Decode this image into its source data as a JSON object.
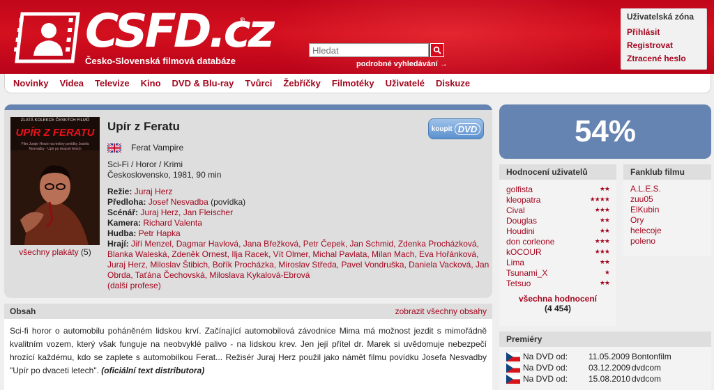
{
  "header": {
    "logo": "CSFD.cz",
    "reg": "®",
    "tagline": "Česko-Slovenská filmová databáze",
    "search_placeholder": "Hledat",
    "adv_search": "podrobné vyhledávání →",
    "user_zone": {
      "title": "Uživatelská zóna",
      "links": [
        "Přihlásit",
        "Registrovat",
        "Ztracené heslo"
      ]
    }
  },
  "nav": [
    "Novinky",
    "Videa",
    "Televize",
    "Kino",
    "DVD & Blu-ray",
    "Tvůrci",
    "Žebříčky",
    "Filmotéky",
    "Uživatelé",
    "Diskuze"
  ],
  "film": {
    "poster": {
      "collection": "ZLATÁ KOLEKCE ČESKÝCH FILMŮ",
      "title": "UPÍR Z FERATU",
      "sub": "Film Juraje Herze na motivy povídky Josefa Nesvadby · Upír po dvaceti letech"
    },
    "all_posters": "všechny plakáty",
    "posters_count": "(5)",
    "title": "Upír z Feratu",
    "alt_title": "Ferat Vampire",
    "genres": "Sci-Fi / Horor / Krimi",
    "origin": "Československo, 1981, 90 min",
    "buy": {
      "kup": "koupit",
      "dvd": "DVD"
    },
    "credits": {
      "directing_label": "Režie:",
      "directing": "Juraj Herz",
      "source_label": "Předloha:",
      "source": "Josef Nesvadba",
      "source_note": "(povídka)",
      "screenplay_label": "Scénář:",
      "screenplay": "Juraj Herz, Jan Fleischer",
      "camera_label": "Kamera:",
      "camera": "Richard Valenta",
      "music_label": "Hudba:",
      "music": "Petr Hapka",
      "cast_label": "Hrají:",
      "cast": "Jiří Menzel, Dagmar Havlová, Jana Břežková, Petr Čepek, Jan Schmid, Zdenka Procházková, Blanka Waleská, Zdeněk Ornest, Ilja Racek, Vít Olmer, Michal Pavlata, Milan Mach, Eva Hořánková, Juraj Herz, Miloslav Štibich, Bořík Procházka, Miroslav Středa, Pavel Vondruška, Daniela Vacková, Jan Obrda, Taťána Čechovská, Miloslava Kykalová-Ebrová",
      "more": "(další profese)"
    }
  },
  "content": {
    "title": "Obsah",
    "show_all": "zobrazit všechny obsahy",
    "plot": "Sci-fi horor o automobilu poháněném lidskou krví. Začínající automobilová závodnice Mima má možnost jezdit s mimořádně kvalitním vozem, který však funguje na neobvyklé palivo - na lidskou krev. Jen její přítel dr. Marek si uvědomuje nebezpečí hrozící každému, kdo se zaplete s automobilkou Ferat... Režisér Juraj Herz použil jako námět filmu povídku Josefa Nesvadby \"Upír po dvaceti letech\". ",
    "plot_source": "(oficiální text distributora)"
  },
  "rating": "54%",
  "user_ratings": {
    "title": "Hodnocení uživatelů",
    "items": [
      {
        "user": "golfista",
        "stars": "★★"
      },
      {
        "user": "kleopatra",
        "stars": "★★★★"
      },
      {
        "user": "Cival",
        "stars": "★★★"
      },
      {
        "user": "Douglas",
        "stars": "★★"
      },
      {
        "user": "Houdini",
        "stars": "★★"
      },
      {
        "user": "don corleone",
        "stars": "★★★"
      },
      {
        "user": "kOCOUR",
        "stars": "★★★"
      },
      {
        "user": "Lima",
        "stars": "★★"
      },
      {
        "user": "Tsunami_X",
        "stars": "★"
      },
      {
        "user": "Tetsuo",
        "stars": "★★"
      }
    ],
    "all": "všechna hodnocení",
    "count": "(4 454)"
  },
  "fanclub": {
    "title": "Fanklub filmu",
    "items": [
      "A.L.E.S.",
      "zuu05",
      "ElKubin",
      "Ory",
      "helecoje",
      "poleno"
    ]
  },
  "premieres": {
    "title": "Premiéry",
    "items": [
      {
        "label": "Na DVD od:",
        "date": "11.05.2009",
        "company": "Bontonfilm"
      },
      {
        "label": "Na DVD od:",
        "date": "03.12.2009",
        "company": "dvdcom"
      },
      {
        "label": "Na DVD od:",
        "date": "15.08.2010",
        "company": "dvdcom"
      }
    ]
  },
  "colors": {
    "brand_red": "#d4101e",
    "link": "#a3071f",
    "accent_blue": "#6584b1"
  }
}
